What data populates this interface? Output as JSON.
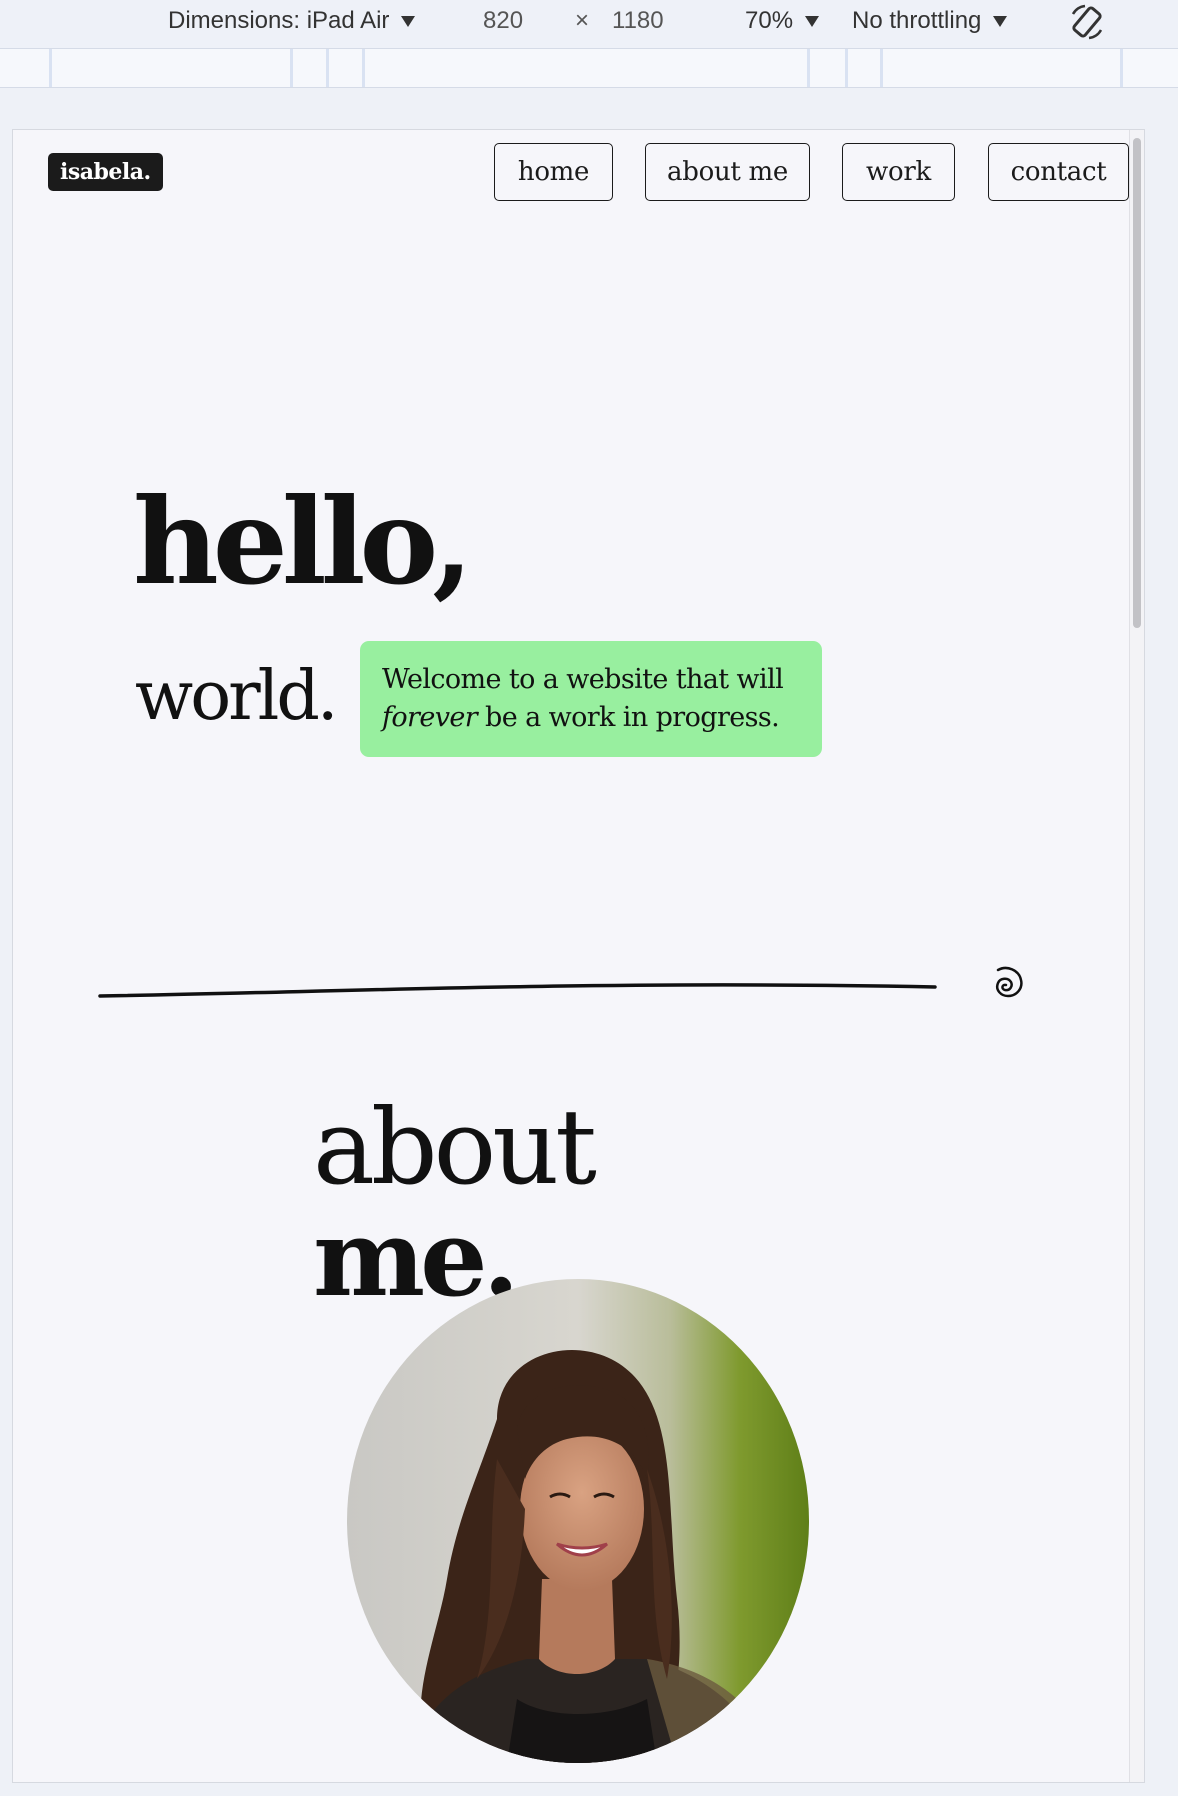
{
  "devtools": {
    "dimensions_label": "Dimensions: iPad Air",
    "width": "820",
    "times": "×",
    "height": "1180",
    "zoom": "70%",
    "throttling": "No throttling",
    "rotate_icon": "rotate-icon"
  },
  "site": {
    "logo": "isabela.",
    "nav": [
      {
        "label": "home"
      },
      {
        "label": "about me"
      },
      {
        "label": "work"
      },
      {
        "label": "contact"
      }
    ],
    "hero": {
      "hello": "hello,",
      "world": "world.",
      "welcome_line1": "Welcome to a website that will",
      "welcome_italic": "forever",
      "welcome_rest": " be a work in progress."
    },
    "spiral_icon": "spiral-icon",
    "about": {
      "line1": "about",
      "line2": "me."
    },
    "colors": {
      "accent_green": "#98ef9f",
      "ink": "#111111",
      "page_bg": "#f6f6fa"
    }
  }
}
